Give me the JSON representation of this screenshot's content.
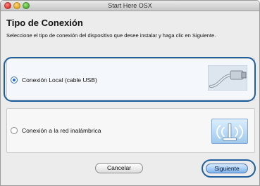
{
  "window": {
    "title": "Start Here OSX"
  },
  "page": {
    "title": "Tipo de Conexión",
    "instructions": "Seleccione el tipo de conexión del dispositivo que desee instalar y haga clic en Siguiente."
  },
  "options": [
    {
      "label": "Conexión Local (cable USB)",
      "selected": true,
      "image": "usb-cable"
    },
    {
      "label": "Conexión a la red inalámbrica",
      "selected": false,
      "image": "wireless-router"
    }
  ],
  "buttons": {
    "cancel": "Cancelar",
    "next": "Siguiente"
  },
  "colors": {
    "highlight": "#1f5f9f",
    "radio_selected": "#2a6fd0"
  }
}
